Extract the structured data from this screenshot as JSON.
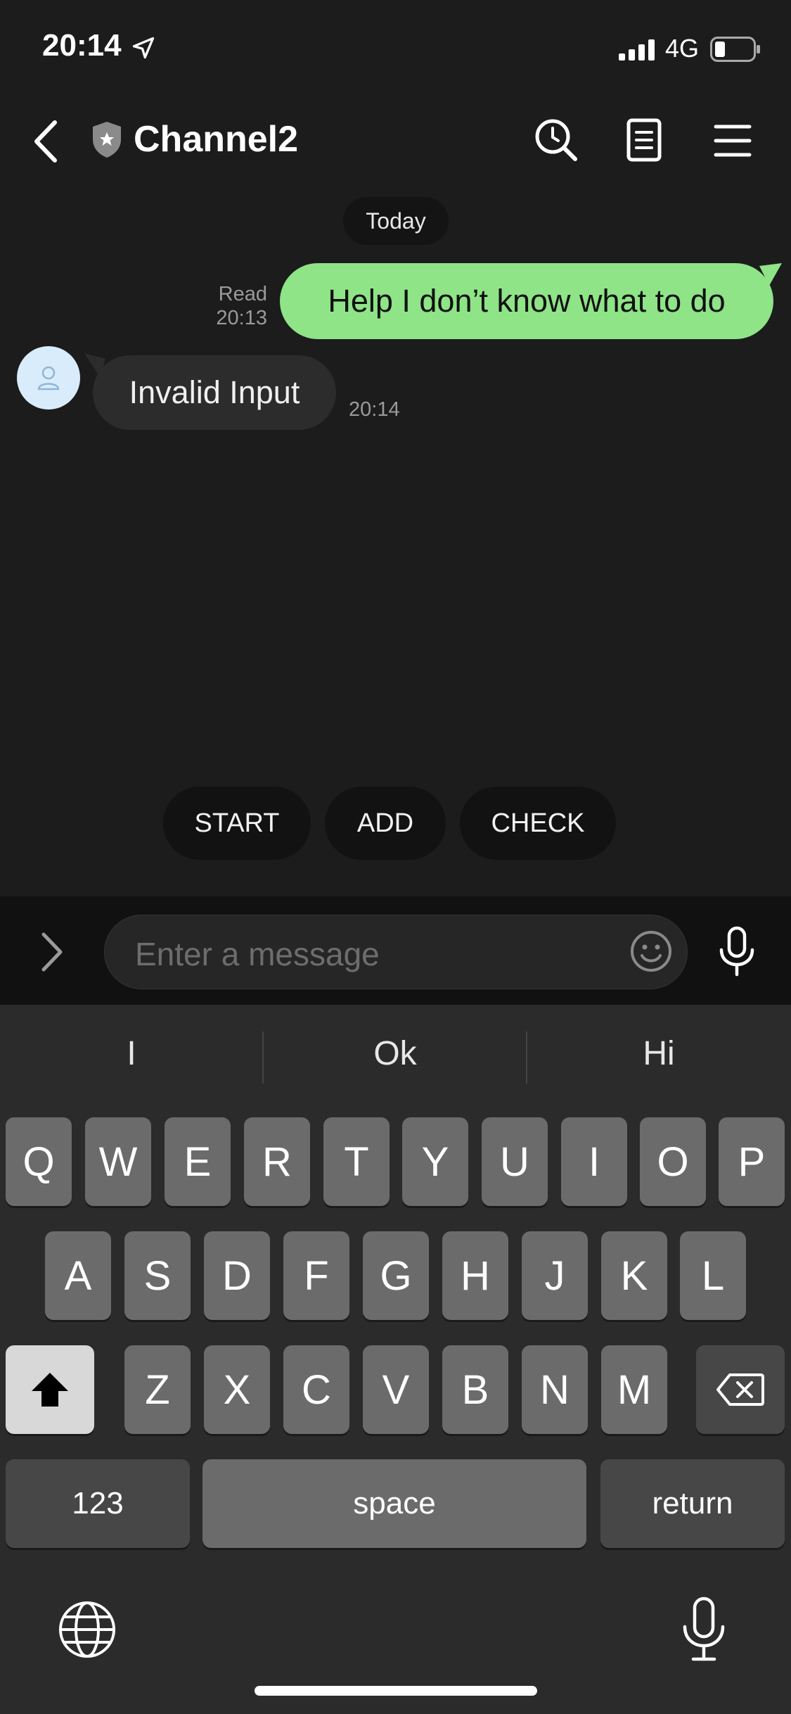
{
  "status_bar": {
    "time": "20:14",
    "network": "4G"
  },
  "header": {
    "title": "Channel2"
  },
  "chat": {
    "date_label": "Today",
    "sent": {
      "text": "Help I don’t know what to do",
      "read_label": "Read",
      "time": "20:13"
    },
    "received": {
      "text": "Invalid Input",
      "time": "20:14"
    }
  },
  "quick_replies": [
    "START",
    "ADD",
    "CHECK"
  ],
  "input": {
    "placeholder": "Enter a message"
  },
  "keyboard": {
    "suggestions": [
      "I",
      "Ok",
      "Hi"
    ],
    "row1": [
      "Q",
      "W",
      "E",
      "R",
      "T",
      "Y",
      "U",
      "I",
      "O",
      "P"
    ],
    "row2": [
      "A",
      "S",
      "D",
      "F",
      "G",
      "H",
      "J",
      "K",
      "L"
    ],
    "row3": [
      "Z",
      "X",
      "C",
      "V",
      "B",
      "N",
      "M"
    ],
    "numbers_label": "123",
    "space_label": "space",
    "return_label": "return"
  },
  "colors": {
    "sent_bubble": "#8ee486",
    "received_bubble": "#2c2c2c",
    "background": "#1c1c1c",
    "keyboard": "#2b2b2b"
  },
  "icons": [
    "location-arrow-icon",
    "signal-icon",
    "battery-icon",
    "back-chevron-icon",
    "shield-badge-icon",
    "search-clock-icon",
    "notes-icon",
    "menu-icon",
    "expand-chevron-icon",
    "emoji-icon",
    "microphone-icon",
    "shift-icon",
    "delete-icon",
    "globe-icon",
    "dictation-icon"
  ]
}
